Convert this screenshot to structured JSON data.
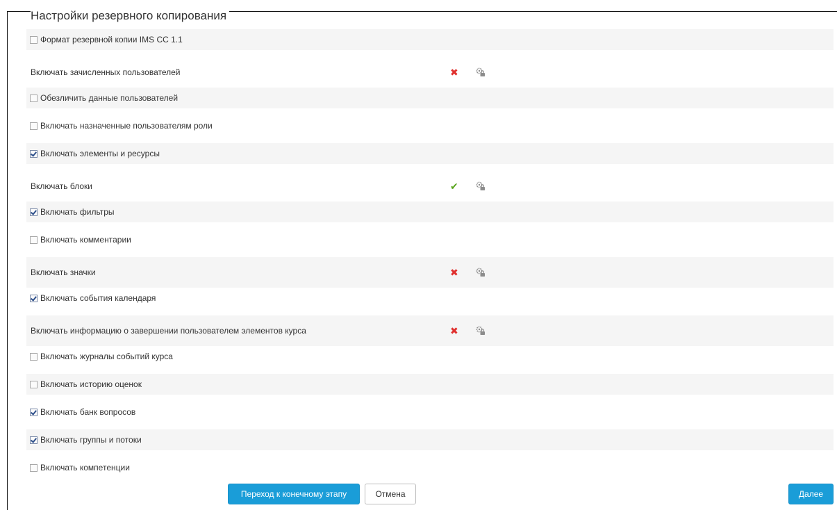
{
  "page": {
    "title": "Настройки резервного копирования"
  },
  "colors": {
    "primary": "#1a9dd8",
    "cross": "#e0302e",
    "check": "#5aa51e",
    "row_stripe": "#f5f5f5"
  },
  "settings": [
    {
      "type": "checkbox",
      "label": "Формат резервной копии IMS CC 1.1",
      "checked": false
    },
    {
      "type": "locked",
      "label": "Включать зачисленных пользователей",
      "status": "no",
      "status_icon": "✖",
      "lock_icon": "lock-gear-icon"
    },
    {
      "type": "checkbox",
      "label": "Обезличить данные пользователей",
      "checked": false
    },
    {
      "type": "checkbox",
      "label": "Включать назначенные пользователям роли",
      "checked": false
    },
    {
      "type": "checkbox",
      "label": "Включать элементы и ресурсы",
      "checked": true
    },
    {
      "type": "locked",
      "label": "Включать блоки",
      "status": "yes",
      "status_icon": "✔",
      "lock_icon": "lock-gear-icon"
    },
    {
      "type": "checkbox",
      "label": "Включать фильтры",
      "checked": true
    },
    {
      "type": "checkbox",
      "label": "Включать комментарии",
      "checked": false
    },
    {
      "type": "locked",
      "label": "Включать значки",
      "status": "no",
      "status_icon": "✖",
      "lock_icon": "lock-gear-icon"
    },
    {
      "type": "checkbox",
      "label": "Включать события календаря",
      "checked": true
    },
    {
      "type": "locked",
      "label": "Включать информацию о завершении пользователем элементов курса",
      "status": "no",
      "status_icon": "✖",
      "lock_icon": "lock-gear-icon"
    },
    {
      "type": "checkbox",
      "label": "Включать журналы событий курса",
      "checked": false
    },
    {
      "type": "checkbox",
      "label": "Включать историю оценок",
      "checked": false
    },
    {
      "type": "checkbox",
      "label": "Включать банк вопросов",
      "checked": true
    },
    {
      "type": "checkbox",
      "label": "Включать группы и потоки",
      "checked": true
    },
    {
      "type": "checkbox",
      "label": "Включать компетенции",
      "checked": false
    }
  ],
  "buttons": {
    "final_step": "Переход к конечному этапу",
    "cancel": "Отмена",
    "next": "Далее"
  }
}
